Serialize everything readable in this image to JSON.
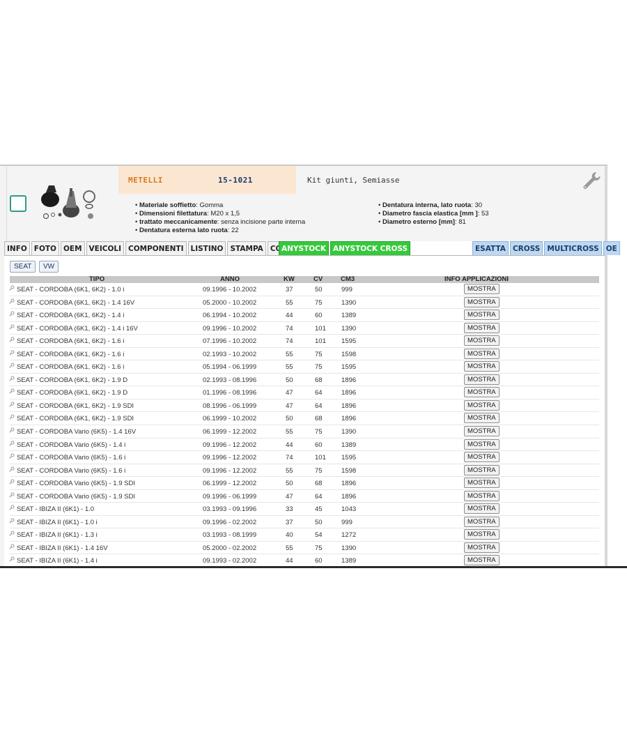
{
  "product": {
    "brand": "METELLI",
    "code": "15-1021",
    "description": "Kit giunti, Semiasse"
  },
  "specs_left": [
    {
      "key": "Materiale soffietto",
      "value": ": Gomma"
    },
    {
      "key": "Dimensioni filettatura",
      "value": ": M20 x 1,5"
    },
    {
      "key": "trattato meccanicamente",
      "value": ": senza incisione parte interna"
    },
    {
      "key": "Dentatura esterna lato ruota",
      "value": ": 22"
    }
  ],
  "specs_right": [
    {
      "key": "Dentatura interna, lato ruota",
      "value": ": 30"
    },
    {
      "key": "Diametro fascia elastica [mm ]",
      "value": ": 53"
    },
    {
      "key": "Diametro esterno [mm]",
      "value": ": 81"
    }
  ],
  "tabs_left": [
    "INFO",
    "FOTO",
    "OEM",
    "VEICOLI",
    "COMPONENTI",
    "LISTINO",
    "STAMPA",
    "COMPRA"
  ],
  "tabs_green": [
    "ANYSTOCK",
    "ANYSTOCK CROSS"
  ],
  "tabs_right": [
    "ESATTA",
    "CROSS",
    "MULTICROSS",
    "OE"
  ],
  "filters": [
    "SEAT",
    "VW"
  ],
  "table": {
    "headers": {
      "tipo": "TIPO",
      "anno": "ANNO",
      "kw": "KW",
      "cv": "CV",
      "cm3": "CM3",
      "info": "INFO APPLICAZIONI"
    },
    "button_label": "MOSTRA",
    "rows": [
      {
        "tipo": "SEAT - CORDOBA (6K1, 6K2) - 1.0 i",
        "anno": "09.1996 - 10.2002",
        "kw": "37",
        "cv": "50",
        "cm3": "999"
      },
      {
        "tipo": "SEAT - CORDOBA (6K1, 6K2) - 1.4 16V",
        "anno": "05.2000 - 10.2002",
        "kw": "55",
        "cv": "75",
        "cm3": "1390"
      },
      {
        "tipo": "SEAT - CORDOBA (6K1, 6K2) - 1.4 i",
        "anno": "06.1994 - 10.2002",
        "kw": "44",
        "cv": "60",
        "cm3": "1389"
      },
      {
        "tipo": "SEAT - CORDOBA (6K1, 6K2) - 1.4 i 16V",
        "anno": "09.1996 - 10.2002",
        "kw": "74",
        "cv": "101",
        "cm3": "1390"
      },
      {
        "tipo": "SEAT - CORDOBA (6K1, 6K2) - 1.6 i",
        "anno": "07.1996 - 10.2002",
        "kw": "74",
        "cv": "101",
        "cm3": "1595"
      },
      {
        "tipo": "SEAT - CORDOBA (6K1, 6K2) - 1.6 i",
        "anno": "02.1993 - 10.2002",
        "kw": "55",
        "cv": "75",
        "cm3": "1598"
      },
      {
        "tipo": "SEAT - CORDOBA (6K1, 6K2) - 1.6 i",
        "anno": "05.1994 - 06.1999",
        "kw": "55",
        "cv": "75",
        "cm3": "1595"
      },
      {
        "tipo": "SEAT - CORDOBA (6K1, 6K2) - 1.9 D",
        "anno": "02.1993 - 08.1996",
        "kw": "50",
        "cv": "68",
        "cm3": "1896"
      },
      {
        "tipo": "SEAT - CORDOBA (6K1, 6K2) - 1.9 D",
        "anno": "01.1996 - 08.1996",
        "kw": "47",
        "cv": "64",
        "cm3": "1896"
      },
      {
        "tipo": "SEAT - CORDOBA (6K1, 6K2) - 1.9 SDI",
        "anno": "08.1996 - 06.1999",
        "kw": "47",
        "cv": "64",
        "cm3": "1896"
      },
      {
        "tipo": "SEAT - CORDOBA (6K1, 6K2) - 1.9 SDI",
        "anno": "06.1999 - 10.2002",
        "kw": "50",
        "cv": "68",
        "cm3": "1896"
      },
      {
        "tipo": "SEAT - CORDOBA Vario (6K5) - 1.4 16V",
        "anno": "06.1999 - 12.2002",
        "kw": "55",
        "cv": "75",
        "cm3": "1390"
      },
      {
        "tipo": "SEAT - CORDOBA Vario (6K5) - 1.4 i",
        "anno": "09.1996 - 12.2002",
        "kw": "44",
        "cv": "60",
        "cm3": "1389"
      },
      {
        "tipo": "SEAT - CORDOBA Vario (6K5) - 1.6 i",
        "anno": "09.1996 - 12.2002",
        "kw": "74",
        "cv": "101",
        "cm3": "1595"
      },
      {
        "tipo": "SEAT - CORDOBA Vario (6K5) - 1.6 i",
        "anno": "09.1996 - 12.2002",
        "kw": "55",
        "cv": "75",
        "cm3": "1598"
      },
      {
        "tipo": "SEAT - CORDOBA Vario (6K5) - 1.9 SDI",
        "anno": "06.1999 - 12.2002",
        "kw": "50",
        "cv": "68",
        "cm3": "1896"
      },
      {
        "tipo": "SEAT - CORDOBA Vario (6K5) - 1.9 SDI",
        "anno": "09.1996 - 06.1999",
        "kw": "47",
        "cv": "64",
        "cm3": "1896"
      },
      {
        "tipo": "SEAT - IBIZA II (6K1) - 1.0",
        "anno": "03.1993 - 09.1996",
        "kw": "33",
        "cv": "45",
        "cm3": "1043"
      },
      {
        "tipo": "SEAT - IBIZA II (6K1) - 1.0 i",
        "anno": "09.1996 - 02.2002",
        "kw": "37",
        "cv": "50",
        "cm3": "999"
      },
      {
        "tipo": "SEAT - IBIZA II (6K1) - 1.3 i",
        "anno": "03.1993 - 08.1999",
        "kw": "40",
        "cv": "54",
        "cm3": "1272"
      },
      {
        "tipo": "SEAT - IBIZA II (6K1) - 1.4 16V",
        "anno": "05.2000 - 02.2002",
        "kw": "55",
        "cv": "75",
        "cm3": "1390"
      },
      {
        "tipo": "SEAT - IBIZA II (6K1) - 1.4 i",
        "anno": "09.1993 - 02.2002",
        "kw": "44",
        "cv": "60",
        "cm3": "1389"
      }
    ]
  },
  "colors": {
    "brand": "#d67b1f",
    "code": "#1b3a6b",
    "anystock_green": "#35c93c",
    "match_blue": "#bcd8f3"
  },
  "icons": {
    "tools": "wrench-icon",
    "row": "magnifier-icon",
    "select": "checkbox-icon"
  }
}
